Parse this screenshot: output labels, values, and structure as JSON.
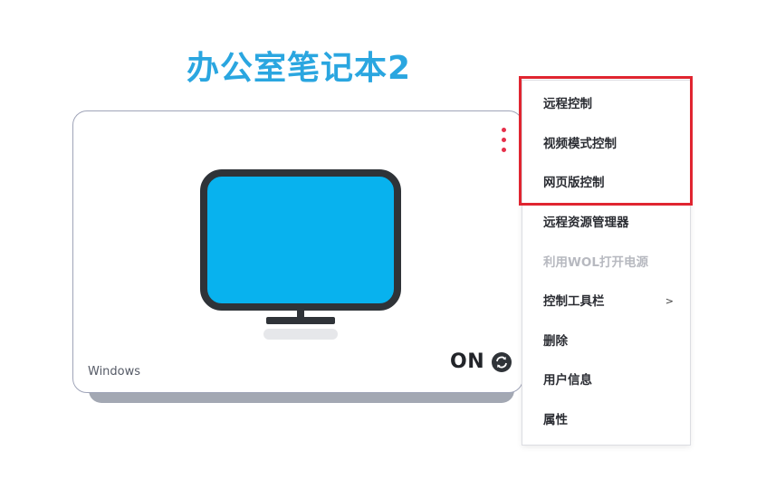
{
  "device": {
    "title": "办公室笔记本2",
    "os": "Windows",
    "status": "ON",
    "icon": "monitor-icon",
    "status_icon": "refresh-icon",
    "more_icon": "kebab-menu-icon"
  },
  "context_menu": {
    "items": [
      {
        "label": "远程控制",
        "enabled": true
      },
      {
        "label": "视频模式控制",
        "enabled": true
      },
      {
        "label": "网页版控制",
        "enabled": true
      },
      {
        "label": "远程资源管理器",
        "enabled": true
      },
      {
        "label": "利用WOL打开电源",
        "enabled": false
      },
      {
        "label": "控制工具栏",
        "enabled": true,
        "submenu_indicator": ">"
      },
      {
        "label": "删除",
        "enabled": true
      },
      {
        "label": "用户信息",
        "enabled": true
      },
      {
        "label": "属性",
        "enabled": true
      }
    ]
  },
  "colors": {
    "title": "#2aa6e0",
    "screen": "#08b2ee",
    "bezel": "#2f3338",
    "kebab": "#e6304a",
    "highlight": "#e02530"
  }
}
